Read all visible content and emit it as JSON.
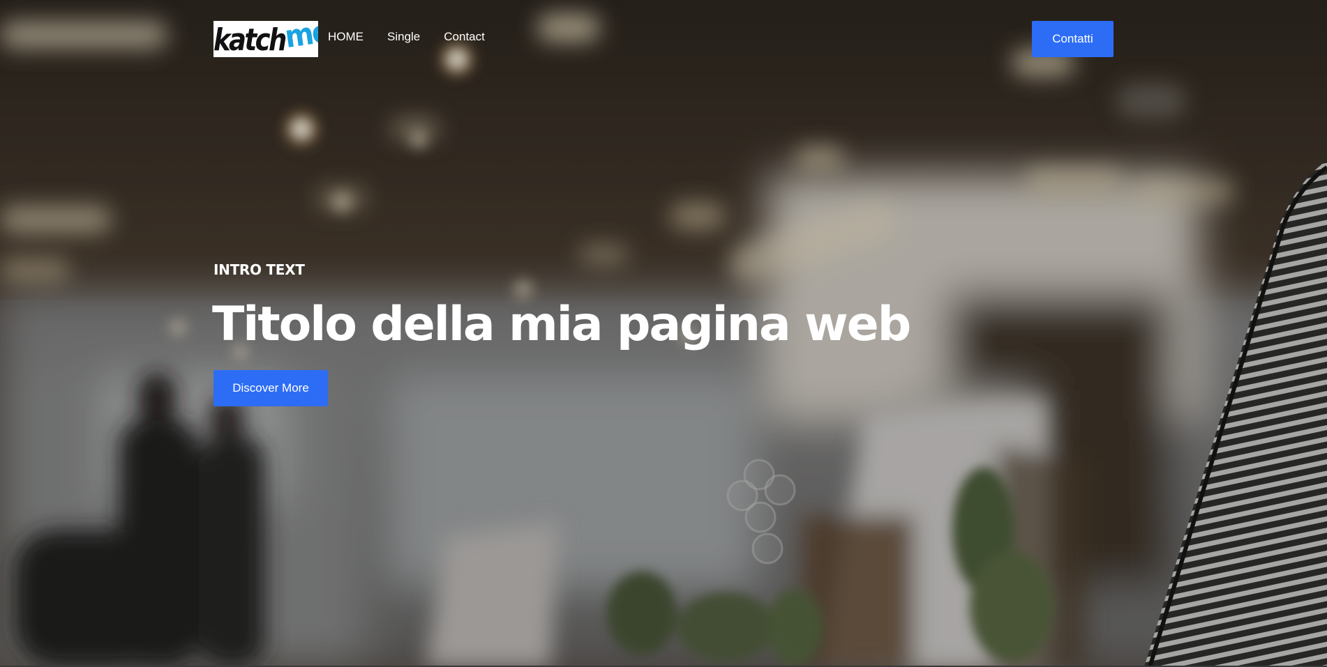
{
  "header": {
    "logo": {
      "part1": "katch",
      "part2": "me"
    },
    "nav": [
      {
        "label": "HOME"
      },
      {
        "label": "Single"
      },
      {
        "label": "Contact"
      }
    ],
    "cta_label": "Contatti"
  },
  "hero": {
    "intro": "INTRO TEXT",
    "title": "Titolo della mia pagina web",
    "button_label": "Discover More",
    "background": "blurred-office-photo"
  },
  "colors": {
    "accent": "#2d6df6",
    "logo_me": "#1aa3e0",
    "text": "#ffffff"
  }
}
